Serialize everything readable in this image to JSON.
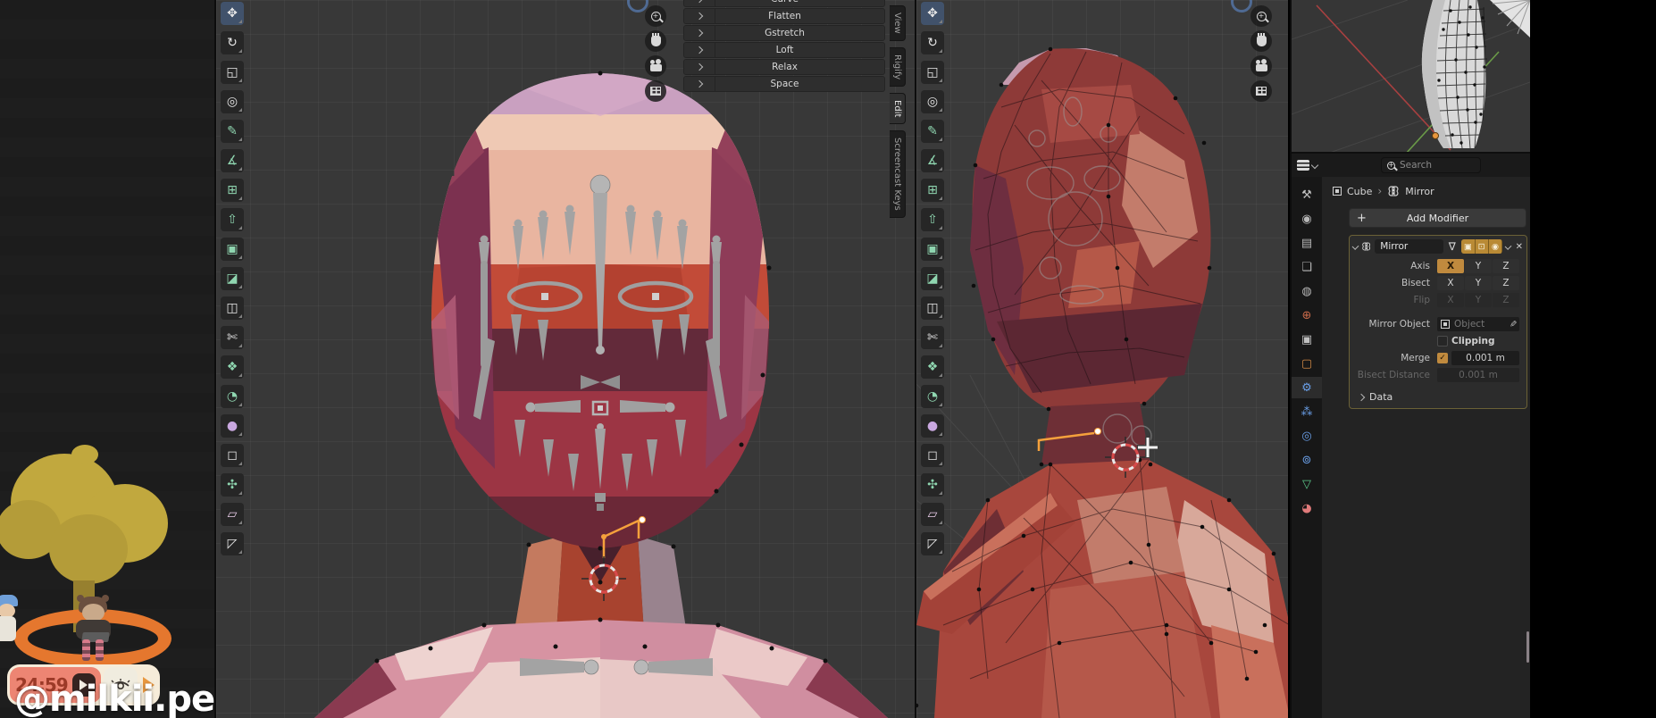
{
  "overlay": {
    "handle": "@milkii.peaches",
    "timer": {
      "time": "24:59"
    }
  },
  "viewport_tools": [
    {
      "name": "move-tool",
      "glyph": "✥",
      "color": "#e6e6e6",
      "active": true
    },
    {
      "name": "rotate-tool",
      "glyph": "↻",
      "color": "#e6e6e6"
    },
    {
      "name": "scale-tool",
      "glyph": "◱",
      "color": "#e6e6e6"
    },
    {
      "name": "transform-tool",
      "glyph": "◎",
      "color": "#e6e6e6"
    },
    {
      "name": "annotate-tool",
      "glyph": "✎",
      "color": "#8fd6b0"
    },
    {
      "name": "measure-tool",
      "glyph": "∡",
      "color": "#8fd6b0"
    },
    {
      "name": "add-cube-tool",
      "glyph": "⊞",
      "color": "#8fd6b0"
    },
    {
      "name": "extrude-region-tool",
      "glyph": "⇧",
      "color": "#8fd6b0"
    },
    {
      "name": "inset-faces-tool",
      "glyph": "▣",
      "color": "#8fd6b0"
    },
    {
      "name": "bevel-tool",
      "glyph": "◪",
      "color": "#8fd6b0"
    },
    {
      "name": "loop-cut-tool",
      "glyph": "◫",
      "color": "#e6e6e6"
    },
    {
      "name": "knife-tool",
      "glyph": "✄",
      "color": "#e6e6e6"
    },
    {
      "name": "poly-build-tool",
      "glyph": "❖",
      "color": "#8fd6b0"
    },
    {
      "name": "spin-tool",
      "glyph": "◔",
      "color": "#8fd6b0"
    },
    {
      "name": "smooth-tool",
      "glyph": "●",
      "color": "#c9a8e0"
    },
    {
      "name": "edge-slide-tool",
      "glyph": "◻",
      "color": "#e6e6e6"
    },
    {
      "name": "shrink-fatten-tool",
      "glyph": "✣",
      "color": "#8fd6b0"
    },
    {
      "name": "shear-tool",
      "glyph": "▱",
      "color": "#e8cce8"
    },
    {
      "name": "rip-region-tool",
      "glyph": "◸",
      "color": "#e6e6e6"
    }
  ],
  "looptools_menu": {
    "items": [
      "Curve",
      "Flatten",
      "Gstretch",
      "Loft",
      "Relax",
      "Space"
    ]
  },
  "sidebar_tabs": {
    "items": [
      "View",
      "Rigify",
      "Edit",
      "Screencast Keys"
    ],
    "active": "Edit"
  },
  "properties": {
    "search_placeholder": "Search",
    "breadcrumb": {
      "object": "Cube",
      "separator": "›",
      "modifier": "Mirror"
    },
    "add_modifier": {
      "plus": "+",
      "label": "Add Modifier"
    },
    "tabs": [
      {
        "name": "tool-tab",
        "glyph": "⚒",
        "color": "#c0c0c0"
      },
      {
        "name": "render-tab",
        "glyph": "◉",
        "color": "#b8b8b8"
      },
      {
        "name": "output-tab",
        "glyph": "▤",
        "color": "#b8b8b8"
      },
      {
        "name": "view-layer-tab",
        "glyph": "❏",
        "color": "#b8b8b8"
      },
      {
        "name": "scene-tab",
        "glyph": "◍",
        "color": "#b8b8b8"
      },
      {
        "name": "world-tab",
        "glyph": "⊕",
        "color": "#c96a4a"
      },
      {
        "name": "collection-tab",
        "glyph": "▣",
        "color": "#c0c0c0"
      },
      {
        "name": "object-tab",
        "glyph": "▢",
        "color": "#d28a45"
      },
      {
        "name": "modifiers-tab",
        "glyph": "⚙",
        "color": "#6a9fe8",
        "active": true
      },
      {
        "name": "particles-tab",
        "glyph": "⁂",
        "color": "#6a9fe8"
      },
      {
        "name": "physics-tab",
        "glyph": "◎",
        "color": "#6a9fe8"
      },
      {
        "name": "constraints-tab",
        "glyph": "⊚",
        "color": "#6a9fe8"
      },
      {
        "name": "object-data-tab",
        "glyph": "▽",
        "color": "#5dc98a"
      },
      {
        "name": "material-tab",
        "glyph": "◕",
        "color": "#e07a7a"
      }
    ],
    "modifier": {
      "name": "Mirror",
      "axis_label": "Axis",
      "bisect_label": "Bisect",
      "flip_label": "Flip",
      "axes": [
        "X",
        "Y",
        "Z"
      ],
      "axis_selected": "X",
      "mirror_object_label": "Mirror Object",
      "mirror_object_placeholder": "Object",
      "clipping_label": "Clipping",
      "merge_label": "Merge",
      "merge_check": "✓",
      "merge_value": "0.001 m",
      "bisect_distance_label": "Bisect Distance",
      "bisect_distance_value": "0.001 m",
      "data_label": "Data"
    }
  },
  "colors": {
    "accent": "#bd8a3e",
    "selection_orange": "#f5a13c",
    "modifier_outline": "#6b6136",
    "viewport_bg": "#383838"
  }
}
